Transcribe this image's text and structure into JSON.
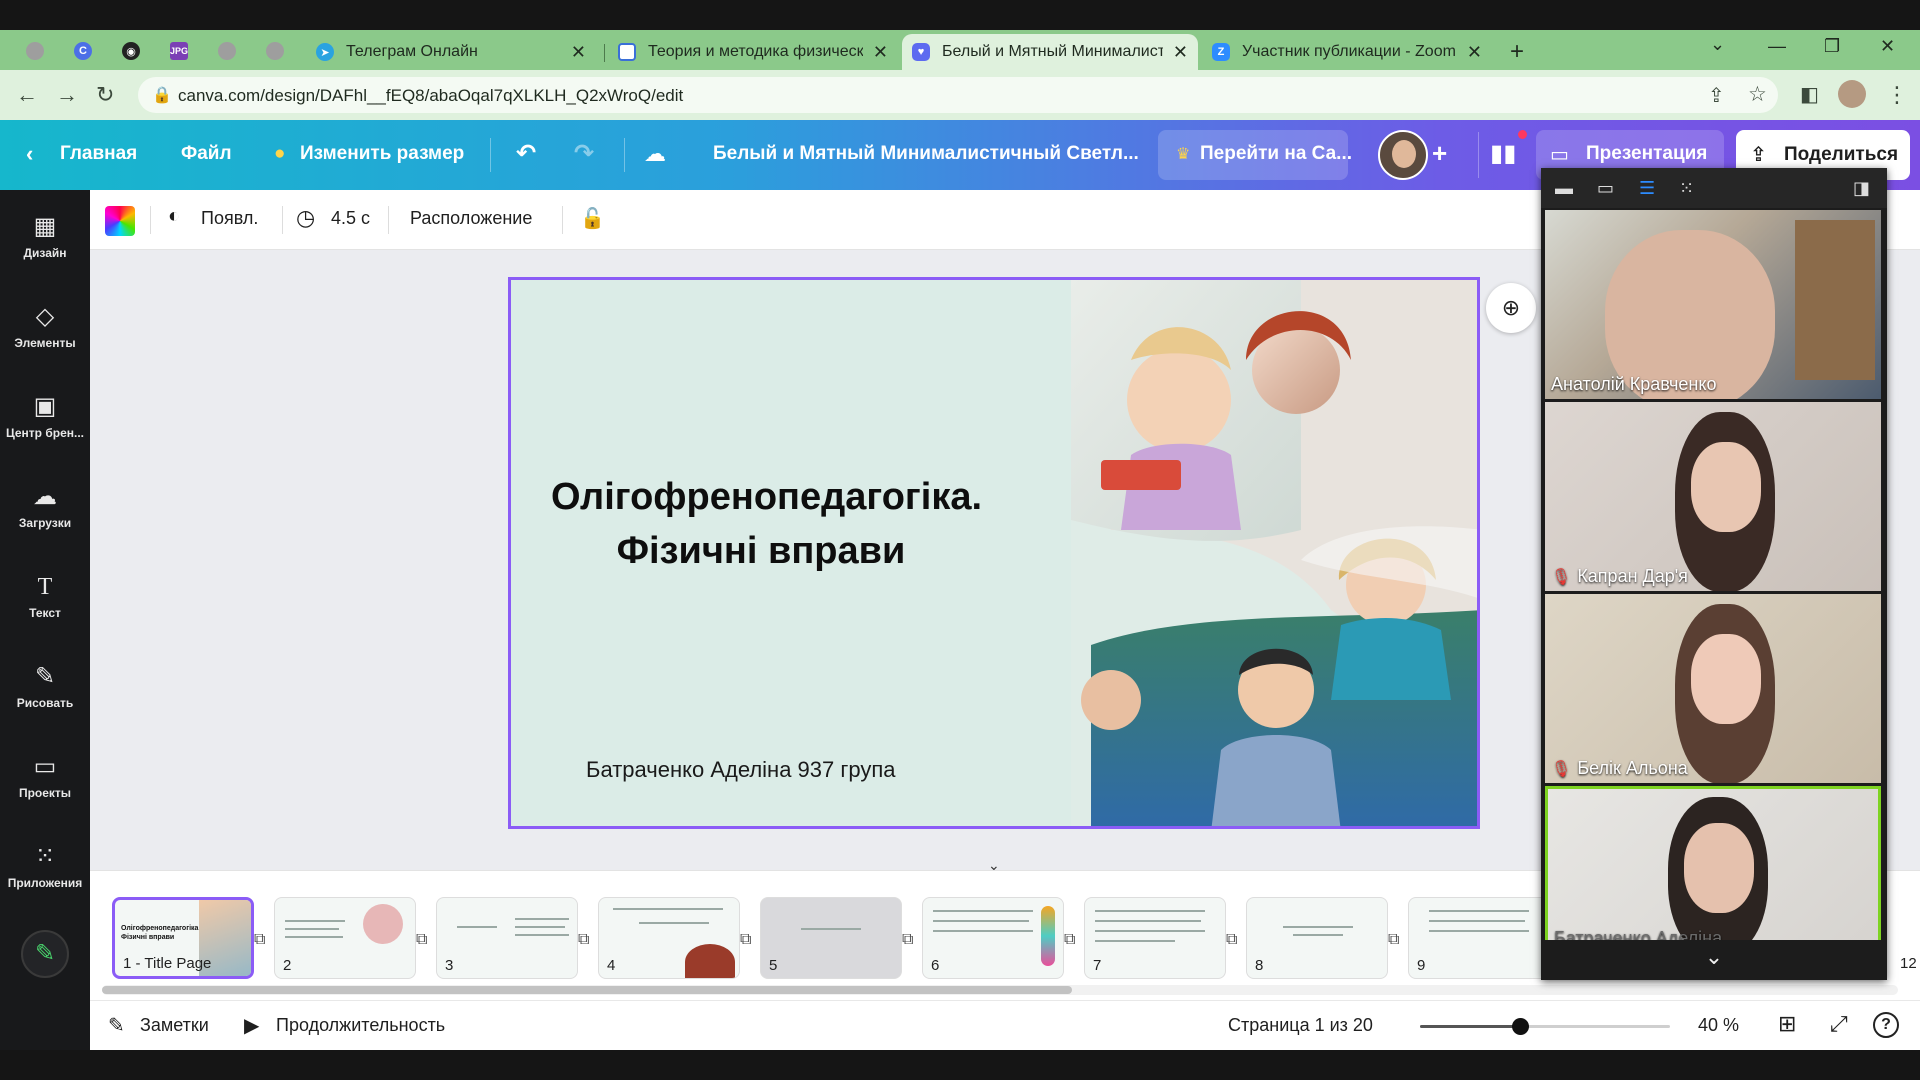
{
  "browser": {
    "tabs": [
      {
        "title": "Телеграм Онлайн",
        "icon": "telegram-icon",
        "active": false
      },
      {
        "title": "Теория и методика физическог",
        "icon": "document-icon",
        "active": false
      },
      {
        "title": "Белый и Мятный Минималисти",
        "icon": "canva-icon",
        "active": true
      },
      {
        "title": "Участник публикации - Zoom",
        "icon": "zoom-icon",
        "active": false
      }
    ],
    "mini_tabs": [
      "globe-icon",
      "circle-c-icon",
      "chrome-icon",
      "jpg-icon",
      "globe-icon",
      "globe-icon"
    ],
    "close_glyph": "✕",
    "new_tab_glyph": "+",
    "url": "canva.com/design/DAFhl__fEQ8/abaOqal7qXLKLH_Q2xWroQ/edit"
  },
  "canva_header": {
    "home": "Главная",
    "file": "Файл",
    "resize": "Изменить размер",
    "doc_title": "Белый и Мятный Минималистичный Светл...",
    "upgrade": "Перейти на Са...",
    "present": "Презентация",
    "share": "Поделиться"
  },
  "sidebar": {
    "items": [
      {
        "label": "Дизайн",
        "icon": "design-icon"
      },
      {
        "label": "Элементы",
        "icon": "elements-icon"
      },
      {
        "label": "Центр брен...",
        "icon": "brand-icon"
      },
      {
        "label": "Загрузки",
        "icon": "upload-icon"
      },
      {
        "label": "Текст",
        "icon": "text-icon"
      },
      {
        "label": "Рисовать",
        "icon": "draw-icon"
      },
      {
        "label": "Проекты",
        "icon": "folder-icon"
      },
      {
        "label": "Приложения",
        "icon": "apps-icon"
      }
    ]
  },
  "toolbar": {
    "animate": "Появл.",
    "duration": "4.5 с",
    "position": "Расположение"
  },
  "slide": {
    "title_line1": "Олігофренопедагогіка.",
    "title_line2": "Фізичні вправи",
    "author": "Батраченко Аделіна 937 група"
  },
  "filmstrip": {
    "thumbs": [
      {
        "label": "1 - Title Page",
        "mini_title": "Олігофренопедагогіка. Фізичні вправи"
      },
      {
        "label": "2",
        "mini_title": ""
      },
      {
        "label": "3",
        "mini_title": ""
      },
      {
        "label": "4",
        "mini_title": ""
      },
      {
        "label": "5",
        "mini_title": ""
      },
      {
        "label": "6",
        "mini_title": ""
      },
      {
        "label": "7",
        "mini_title": ""
      },
      {
        "label": "8",
        "mini_title": ""
      },
      {
        "label": "9",
        "mini_title": ""
      }
    ],
    "next_number": "12"
  },
  "bottombar": {
    "notes": "Заметки",
    "duration": "Продолжительность",
    "page": "Страница 1 из 20",
    "zoom": "40 %",
    "zoom_level": 0.4
  },
  "zoom_panel": {
    "participants": [
      {
        "name": "Анатолій Кравченко",
        "muted": false,
        "speaking": false
      },
      {
        "name": "Капран Дар'я",
        "muted": true,
        "speaking": false
      },
      {
        "name": "Белік Альона",
        "muted": true,
        "speaking": false
      },
      {
        "name": "Батраченко Аделіна",
        "muted": false,
        "speaking": true
      }
    ]
  },
  "colors": {
    "tabstrip": "#8bc98a",
    "canva_gradient_start": "#16b7cc",
    "canva_gradient_end": "#7b4fe3",
    "selection": "#8b5cf6",
    "slide_bg": "#dbece7"
  }
}
